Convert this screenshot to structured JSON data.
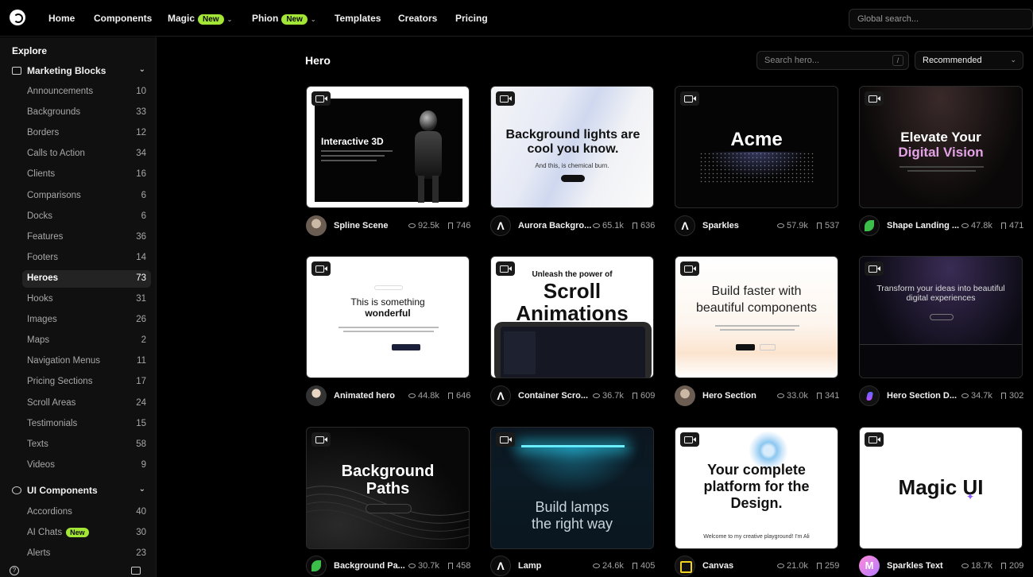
{
  "nav": {
    "items": [
      {
        "label": "Home"
      },
      {
        "label": "Components"
      },
      {
        "label": "Magic",
        "badge": "New"
      },
      {
        "label": "Phion",
        "badge": "New"
      },
      {
        "label": "Templates"
      },
      {
        "label": "Creators"
      },
      {
        "label": "Pricing"
      }
    ],
    "search_placeholder": "Global search..."
  },
  "sidebar": {
    "heading": "Explore",
    "sections": [
      {
        "title": "Marketing Blocks"
      },
      {
        "title": "UI Components"
      }
    ],
    "marketing_items": [
      {
        "label": "Announcements",
        "count": "10"
      },
      {
        "label": "Backgrounds",
        "count": "33"
      },
      {
        "label": "Borders",
        "count": "12"
      },
      {
        "label": "Calls to Action",
        "count": "34"
      },
      {
        "label": "Clients",
        "count": "16"
      },
      {
        "label": "Comparisons",
        "count": "6"
      },
      {
        "label": "Docks",
        "count": "6"
      },
      {
        "label": "Features",
        "count": "36"
      },
      {
        "label": "Footers",
        "count": "14"
      },
      {
        "label": "Heroes",
        "count": "73"
      },
      {
        "label": "Hooks",
        "count": "31"
      },
      {
        "label": "Images",
        "count": "26"
      },
      {
        "label": "Maps",
        "count": "2"
      },
      {
        "label": "Navigation Menus",
        "count": "11"
      },
      {
        "label": "Pricing Sections",
        "count": "17"
      },
      {
        "label": "Scroll Areas",
        "count": "24"
      },
      {
        "label": "Testimonials",
        "count": "15"
      },
      {
        "label": "Texts",
        "count": "58"
      },
      {
        "label": "Videos",
        "count": "9"
      }
    ],
    "ui_items": [
      {
        "label": "Accordions",
        "count": "40"
      },
      {
        "label": "AI Chats",
        "count": "30",
        "badge": "New"
      },
      {
        "label": "Alerts",
        "count": "23"
      }
    ]
  },
  "main": {
    "title": "Hero",
    "search_placeholder": "Search hero...",
    "search_shortcut": "/",
    "sort_label": "Recommended"
  },
  "cards": [
    {
      "name": "Spline Scene",
      "views": "92.5k",
      "saves": "746",
      "preview": {
        "title": "Interactive 3D"
      }
    },
    {
      "name": "Aurora Backgro...",
      "views": "65.1k",
      "saves": "636",
      "preview": {
        "title": "Background lights are cool you know.",
        "subtitle": "And this, is chemical burn."
      }
    },
    {
      "name": "Sparkles",
      "views": "57.9k",
      "saves": "537",
      "preview": {
        "title": "Acme"
      }
    },
    {
      "name": "Shape Landing ...",
      "views": "47.8k",
      "saves": "471",
      "preview": {
        "title": "Elevate Your",
        "title2": "Digital Vision"
      }
    },
    {
      "name": "Animated hero",
      "views": "44.8k",
      "saves": "646",
      "preview": {
        "title": "This is something",
        "title2": "wonderful"
      }
    },
    {
      "name": "Container Scro...",
      "views": "36.7k",
      "saves": "609",
      "preview": {
        "subtitle": "Unleash the power of",
        "title": "Scroll",
        "title2": "Animations"
      }
    },
    {
      "name": "Hero Section",
      "views": "33.0k",
      "saves": "341",
      "preview": {
        "title": "Build faster with",
        "title2": "beautiful components"
      }
    },
    {
      "name": "Hero Section D...",
      "views": "34.7k",
      "saves": "302",
      "preview": {
        "title": "Transform your ideas into beautiful",
        "title2": "digital experiences"
      }
    },
    {
      "name": "Background Pa...",
      "views": "30.7k",
      "saves": "458",
      "preview": {
        "title": "Background",
        "title2": "Paths"
      }
    },
    {
      "name": "Lamp",
      "views": "24.6k",
      "saves": "405",
      "preview": {
        "title": "Build lamps",
        "title2": "the right way"
      }
    },
    {
      "name": "Canvas",
      "views": "21.0k",
      "saves": "259",
      "preview": {
        "title": "Your complete",
        "title2": "platform for the",
        "title3": "Design.",
        "subtitle": "Welcome to my creative playground! I'm Ali"
      }
    },
    {
      "name": "Sparkles Text",
      "views": "18.7k",
      "saves": "209",
      "preview": {
        "title": "Magic UI"
      }
    }
  ],
  "colors": {
    "accent": "#a3e635",
    "background": "#000000",
    "sidebar": "#101010"
  }
}
